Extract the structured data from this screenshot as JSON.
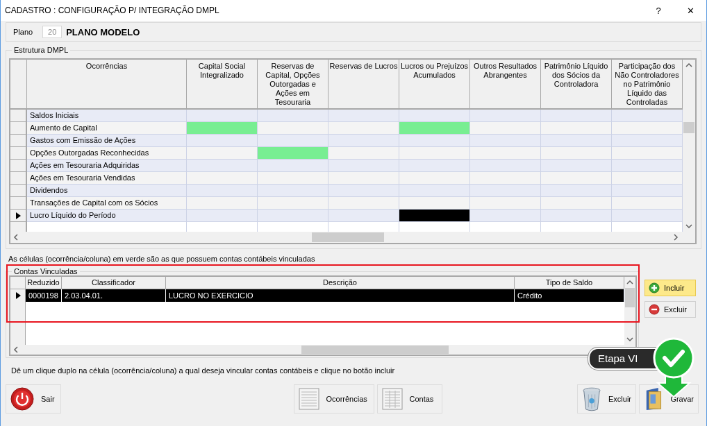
{
  "window": {
    "title": "CADASTRO : CONFIGURAÇÃO P/ INTEGRAÇÃO DMPL",
    "help": "?",
    "close": "✕"
  },
  "plano": {
    "label": "Plano",
    "code": "20",
    "name": "PLANO MODELO"
  },
  "estrutura": {
    "legend": "Estrutura DMPL",
    "columns": [
      "Ocorrências",
      "Capital Social Integralizado",
      "Reservas de Capital, Opções Outorgadas e Ações em Tesouraria",
      "Reservas de Lucros",
      "Lucros ou Prejuízos Acumulados",
      "Outros Resultados Abrangentes",
      "Patrimônio Líquido dos Sócios da Controladora",
      "Participação dos Não Controladores no Patrimônio Líquido das Controladas"
    ],
    "rows": [
      {
        "label": "Saldos Iniciais",
        "selected": false,
        "cells": [
          {
            "linked": false,
            "focused": false
          },
          {
            "linked": false,
            "focused": false
          },
          {
            "linked": false,
            "focused": false
          },
          {
            "linked": false,
            "focused": false
          },
          {
            "linked": false,
            "focused": false
          },
          {
            "linked": false,
            "focused": false
          },
          {
            "linked": false,
            "focused": false
          }
        ]
      },
      {
        "label": "Aumento de Capital",
        "selected": false,
        "cells": [
          {
            "linked": true,
            "focused": false
          },
          {
            "linked": false,
            "focused": false
          },
          {
            "linked": false,
            "focused": false
          },
          {
            "linked": true,
            "focused": false
          },
          {
            "linked": false,
            "focused": false
          },
          {
            "linked": false,
            "focused": false
          },
          {
            "linked": false,
            "focused": false
          }
        ]
      },
      {
        "label": "Gastos com Emissão de Ações",
        "selected": false,
        "cells": [
          {
            "linked": false,
            "focused": false
          },
          {
            "linked": false,
            "focused": false
          },
          {
            "linked": false,
            "focused": false
          },
          {
            "linked": false,
            "focused": false
          },
          {
            "linked": false,
            "focused": false
          },
          {
            "linked": false,
            "focused": false
          },
          {
            "linked": false,
            "focused": false
          }
        ]
      },
      {
        "label": "Opções Outorgadas Reconhecidas",
        "selected": false,
        "cells": [
          {
            "linked": false,
            "focused": false
          },
          {
            "linked": true,
            "focused": false
          },
          {
            "linked": false,
            "focused": false
          },
          {
            "linked": false,
            "focused": false
          },
          {
            "linked": false,
            "focused": false
          },
          {
            "linked": false,
            "focused": false
          },
          {
            "linked": false,
            "focused": false
          }
        ]
      },
      {
        "label": "Ações em Tesouraria Adquiridas",
        "selected": false,
        "cells": [
          {
            "linked": false,
            "focused": false
          },
          {
            "linked": false,
            "focused": false
          },
          {
            "linked": false,
            "focused": false
          },
          {
            "linked": false,
            "focused": false
          },
          {
            "linked": false,
            "focused": false
          },
          {
            "linked": false,
            "focused": false
          },
          {
            "linked": false,
            "focused": false
          }
        ]
      },
      {
        "label": "Ações em Tesouraria Vendidas",
        "selected": false,
        "cells": [
          {
            "linked": false,
            "focused": false
          },
          {
            "linked": false,
            "focused": false
          },
          {
            "linked": false,
            "focused": false
          },
          {
            "linked": false,
            "focused": false
          },
          {
            "linked": false,
            "focused": false
          },
          {
            "linked": false,
            "focused": false
          },
          {
            "linked": false,
            "focused": false
          }
        ]
      },
      {
        "label": "Dividendos",
        "selected": false,
        "cells": [
          {
            "linked": false,
            "focused": false
          },
          {
            "linked": false,
            "focused": false
          },
          {
            "linked": false,
            "focused": false
          },
          {
            "linked": false,
            "focused": false
          },
          {
            "linked": false,
            "focused": false
          },
          {
            "linked": false,
            "focused": false
          },
          {
            "linked": false,
            "focused": false
          }
        ]
      },
      {
        "label": "Transações de Capital com os Sócios",
        "selected": false,
        "cells": [
          {
            "linked": false,
            "focused": false
          },
          {
            "linked": false,
            "focused": false
          },
          {
            "linked": false,
            "focused": false
          },
          {
            "linked": false,
            "focused": false
          },
          {
            "linked": false,
            "focused": false
          },
          {
            "linked": false,
            "focused": false
          },
          {
            "linked": false,
            "focused": false
          }
        ]
      },
      {
        "label": "Lucro Líquido do Período",
        "selected": true,
        "cells": [
          {
            "linked": false,
            "focused": false
          },
          {
            "linked": false,
            "focused": false
          },
          {
            "linked": false,
            "focused": false
          },
          {
            "linked": false,
            "focused": true
          },
          {
            "linked": false,
            "focused": false
          },
          {
            "linked": false,
            "focused": false
          },
          {
            "linked": false,
            "focused": false
          }
        ]
      }
    ]
  },
  "note": "As células (ocorrência/coluna) em verde são as que possuem contas contábeis vinculadas",
  "contas": {
    "legend": "Contas Vinculadas",
    "highlighted": true,
    "columns": [
      "Reduzido",
      "Classificador",
      "Descrição",
      "Tipo de Saldo"
    ],
    "rows": [
      {
        "selected": true,
        "cells": [
          "0000198",
          "2.03.04.01.",
          "LUCRO NO EXERCICIO",
          "Crédito"
        ]
      }
    ]
  },
  "side_buttons": [
    {
      "kind": "add",
      "label": "Incluir",
      "hovered": true
    },
    {
      "kind": "remove",
      "label": "Excluir",
      "hovered": false
    }
  ],
  "step_badge": "Etapa VI",
  "hint": "Dê um clique duplo na célula (ocorrência/coluna) a qual deseja vincular contas contábeis e clique no botão incluir",
  "footer_left": [
    {
      "kind": "power",
      "label": "Sair"
    }
  ],
  "footer_center": [
    {
      "kind": "list",
      "label": "Ocorrências"
    },
    {
      "kind": "grid",
      "label": "Contas"
    }
  ],
  "footer_right": [
    {
      "kind": "trash",
      "label": "Excluir"
    },
    {
      "kind": "folder",
      "label": "Gravar"
    }
  ]
}
